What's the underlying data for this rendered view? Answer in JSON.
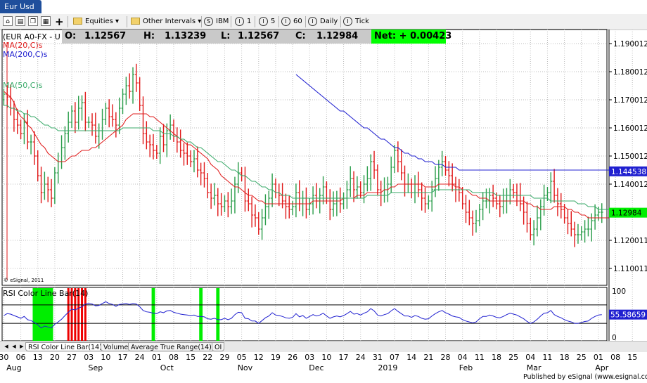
{
  "window": {
    "title": "Eur Usd"
  },
  "toolbar": {
    "equities_label": "Equities",
    "intervals_label": "Other Intervals",
    "intervals": [
      {
        "icon": "S",
        "label": "IBM"
      },
      {
        "icon": "I",
        "label": "1"
      },
      {
        "icon": "I",
        "label": "5"
      },
      {
        "icon": "I",
        "label": "60"
      },
      {
        "icon": "I",
        "label": "Daily"
      },
      {
        "icon": "I",
        "label": "Tick"
      }
    ]
  },
  "header": {
    "symbol": "(EUR A0-FX - U",
    "open_label": "O:",
    "open": "1.12567",
    "high_label": "H:",
    "high": "1.13239",
    "low_label": "L:",
    "low": "1.12567",
    "close_label": "C:",
    "close": "1.12984",
    "net_label": "Net:",
    "net": "+ 0.00423"
  },
  "colors": {
    "up": "#2a9d4a",
    "down": "#e01818",
    "ma20": "#e02020",
    "ma50": "#3aaa6a",
    "ma200": "#2020d0",
    "rsi": "#2020d0",
    "rsi_green": "#00ee00",
    "rsi_red": "#ee0000"
  },
  "chart_data": [
    {
      "type": "candlestick",
      "title": "",
      "copyright": "© eSignal, 2011",
      "ylim": [
        1.104,
        1.195
      ],
      "y_ticks": [
        {
          "value": 1.19,
          "label": "1.190012"
        },
        {
          "value": 1.18,
          "label": "1.180012"
        },
        {
          "value": 1.17,
          "label": "1.170012"
        },
        {
          "value": 1.16,
          "label": "1.160012"
        },
        {
          "value": 1.15,
          "label": "1.150012"
        },
        {
          "value": 1.14,
          "label": "1.140012"
        },
        {
          "value": 1.12,
          "label": "1.120011"
        },
        {
          "value": 1.11,
          "label": "1.110011"
        }
      ],
      "x_ticks": [
        {
          "i": 0,
          "label": "30"
        },
        {
          "i": 5,
          "label": "06"
        },
        {
          "i": 10,
          "label": "13"
        },
        {
          "i": 15,
          "label": "20"
        },
        {
          "i": 20,
          "label": "27"
        },
        {
          "i": 25,
          "label": "03"
        },
        {
          "i": 30,
          "label": "10"
        },
        {
          "i": 35,
          "label": "17"
        },
        {
          "i": 40,
          "label": "24"
        },
        {
          "i": 45,
          "label": "01"
        },
        {
          "i": 50,
          "label": "08"
        },
        {
          "i": 55,
          "label": "15"
        },
        {
          "i": 60,
          "label": "22"
        },
        {
          "i": 65,
          "label": "29"
        },
        {
          "i": 70,
          "label": "05"
        },
        {
          "i": 75,
          "label": "12"
        },
        {
          "i": 80,
          "label": "19"
        },
        {
          "i": 85,
          "label": "26"
        },
        {
          "i": 90,
          "label": "03"
        },
        {
          "i": 95,
          "label": "10"
        },
        {
          "i": 100,
          "label": "17"
        },
        {
          "i": 105,
          "label": "24"
        },
        {
          "i": 110,
          "label": "31"
        },
        {
          "i": 115,
          "label": "07"
        },
        {
          "i": 120,
          "label": "14"
        },
        {
          "i": 125,
          "label": "21"
        },
        {
          "i": 130,
          "label": "28"
        },
        {
          "i": 135,
          "label": "04"
        },
        {
          "i": 140,
          "label": "11"
        },
        {
          "i": 145,
          "label": "18"
        },
        {
          "i": 150,
          "label": "25"
        },
        {
          "i": 155,
          "label": "04"
        },
        {
          "i": 160,
          "label": "11"
        },
        {
          "i": 165,
          "label": "18"
        },
        {
          "i": 170,
          "label": "25"
        },
        {
          "i": 175,
          "label": "01"
        },
        {
          "i": 180,
          "label": "08"
        },
        {
          "i": 185,
          "label": "15"
        }
      ],
      "month_labels": [
        {
          "i": 3,
          "label": "Aug"
        },
        {
          "i": 27,
          "label": "Sep"
        },
        {
          "i": 48,
          "label": "Oct"
        },
        {
          "i": 71,
          "label": "Nov"
        },
        {
          "i": 92,
          "label": "Dec"
        },
        {
          "i": 113,
          "label": "2019"
        },
        {
          "i": 136,
          "label": "Feb"
        },
        {
          "i": 156,
          "label": "Mar"
        },
        {
          "i": 176,
          "label": "Apr"
        }
      ],
      "closes": [
        1.172,
        1.171,
        1.167,
        1.163,
        1.161,
        1.158,
        1.162,
        1.155,
        1.155,
        1.15,
        1.143,
        1.137,
        1.14,
        1.138,
        1.135,
        1.144,
        1.148,
        1.153,
        1.158,
        1.162,
        1.166,
        1.162,
        1.167,
        1.169,
        1.162,
        1.162,
        1.161,
        1.157,
        1.159,
        1.163,
        1.167,
        1.164,
        1.163,
        1.161,
        1.167,
        1.172,
        1.175,
        1.173,
        1.179,
        1.176,
        1.168,
        1.158,
        1.155,
        1.154,
        1.152,
        1.151,
        1.157,
        1.154,
        1.159,
        1.161,
        1.157,
        1.155,
        1.152,
        1.151,
        1.15,
        1.148,
        1.149,
        1.145,
        1.144,
        1.142,
        1.137,
        1.135,
        1.136,
        1.133,
        1.132,
        1.134,
        1.132,
        1.134,
        1.14,
        1.144,
        1.143,
        1.134,
        1.133,
        1.129,
        1.128,
        1.124,
        1.128,
        1.132,
        1.135,
        1.14,
        1.137,
        1.136,
        1.134,
        1.132,
        1.131,
        1.132,
        1.137,
        1.133,
        1.135,
        1.131,
        1.133,
        1.136,
        1.134,
        1.136,
        1.139,
        1.135,
        1.131,
        1.133,
        1.135,
        1.133,
        1.135,
        1.138,
        1.142,
        1.138,
        1.139,
        1.137,
        1.14,
        1.142,
        1.148,
        1.145,
        1.138,
        1.136,
        1.138,
        1.14,
        1.146,
        1.152,
        1.148,
        1.144,
        1.14,
        1.14,
        1.137,
        1.14,
        1.138,
        1.135,
        1.133,
        1.134,
        1.138,
        1.142,
        1.146,
        1.148,
        1.145,
        1.143,
        1.14,
        1.138,
        1.137,
        1.133,
        1.13,
        1.128,
        1.126,
        1.127,
        1.131,
        1.134,
        1.134,
        1.136,
        1.135,
        1.133,
        1.132,
        1.134,
        1.136,
        1.138,
        1.137,
        1.136,
        1.133,
        1.13,
        1.126,
        1.122,
        1.124,
        1.128,
        1.132,
        1.136,
        1.137,
        1.141,
        1.136,
        1.133,
        1.131,
        1.128,
        1.126,
        1.124,
        1.122,
        1.122,
        1.123,
        1.124,
        1.124,
        1.127,
        1.129,
        1.13,
        1.13
      ],
      "series": [
        {
          "name": "MA(20,C)s",
          "values": [
            1.173,
            1.172,
            1.171,
            1.169,
            1.166,
            1.164,
            1.163,
            1.161,
            1.16,
            1.158,
            1.156,
            1.154,
            1.153,
            1.151,
            1.15,
            1.149,
            1.148,
            1.148,
            1.148,
            1.149,
            1.15,
            1.15,
            1.151,
            1.152,
            1.152,
            1.152,
            1.153,
            1.153,
            1.154,
            1.155,
            1.156,
            1.157,
            1.158,
            1.159,
            1.16,
            1.161,
            1.163,
            1.164,
            1.165,
            1.165,
            1.165,
            1.165,
            1.165,
            1.164,
            1.164,
            1.163,
            1.162,
            1.161,
            1.16,
            1.159,
            1.158,
            1.157,
            1.156,
            1.155,
            1.154,
            1.154,
            1.153,
            1.152,
            1.151,
            1.15,
            1.149,
            1.147,
            1.146,
            1.145,
            1.143,
            1.142,
            1.141,
            1.14,
            1.139,
            1.139,
            1.138,
            1.137,
            1.136,
            1.136,
            1.135,
            1.134,
            1.134,
            1.133,
            1.133,
            1.133,
            1.133,
            1.133,
            1.133,
            1.133,
            1.133,
            1.133,
            1.133,
            1.133,
            1.133,
            1.133,
            1.133,
            1.134,
            1.134,
            1.134,
            1.134,
            1.134,
            1.134,
            1.134,
            1.134,
            1.134,
            1.135,
            1.135,
            1.135,
            1.135,
            1.136,
            1.136,
            1.136,
            1.137,
            1.137,
            1.137,
            1.137,
            1.137,
            1.138,
            1.138,
            1.139,
            1.139,
            1.14,
            1.14,
            1.14,
            1.14,
            1.14,
            1.14,
            1.14,
            1.14,
            1.139,
            1.139,
            1.139,
            1.139,
            1.14,
            1.14,
            1.14,
            1.14,
            1.14,
            1.139,
            1.139,
            1.138,
            1.138,
            1.137,
            1.136,
            1.136,
            1.135,
            1.135,
            1.135,
            1.134,
            1.134,
            1.134,
            1.134,
            1.134,
            1.134,
            1.134,
            1.134,
            1.134,
            1.134,
            1.134,
            1.133,
            1.133,
            1.132,
            1.132,
            1.131,
            1.131,
            1.131,
            1.131,
            1.132,
            1.132,
            1.132,
            1.132,
            1.131,
            1.131,
            1.13,
            1.13,
            1.129,
            1.129,
            1.128,
            1.128,
            1.128,
            1.128,
            1.128,
            1.128,
            1.128
          ]
        },
        {
          "name": "MA(50,C)s",
          "values": [
            1.168,
            1.168,
            1.167,
            1.167,
            1.166,
            1.166,
            1.165,
            1.165,
            1.164,
            1.164,
            1.163,
            1.162,
            1.161,
            1.161,
            1.16,
            1.16,
            1.159,
            1.159,
            1.159,
            1.159,
            1.159,
            1.159,
            1.159,
            1.159,
            1.159,
            1.159,
            1.159,
            1.159,
            1.159,
            1.159,
            1.159,
            1.159,
            1.159,
            1.159,
            1.159,
            1.16,
            1.16,
            1.16,
            1.16,
            1.16,
            1.16,
            1.16,
            1.16,
            1.16,
            1.159,
            1.159,
            1.159,
            1.158,
            1.158,
            1.158,
            1.157,
            1.157,
            1.156,
            1.156,
            1.155,
            1.155,
            1.154,
            1.153,
            1.153,
            1.152,
            1.151,
            1.15,
            1.149,
            1.148,
            1.148,
            1.147,
            1.146,
            1.145,
            1.145,
            1.144,
            1.143,
            1.143,
            1.142,
            1.141,
            1.141,
            1.14,
            1.139,
            1.139,
            1.138,
            1.138,
            1.137,
            1.137,
            1.136,
            1.136,
            1.136,
            1.135,
            1.135,
            1.135,
            1.135,
            1.135,
            1.135,
            1.135,
            1.135,
            1.135,
            1.135,
            1.135,
            1.135,
            1.135,
            1.135,
            1.135,
            1.135,
            1.135,
            1.135,
            1.135,
            1.135,
            1.135,
            1.135,
            1.136,
            1.136,
            1.136,
            1.136,
            1.136,
            1.136,
            1.136,
            1.137,
            1.137,
            1.137,
            1.137,
            1.137,
            1.137,
            1.137,
            1.137,
            1.137,
            1.137,
            1.137,
            1.137,
            1.137,
            1.138,
            1.138,
            1.138,
            1.138,
            1.138,
            1.138,
            1.138,
            1.138,
            1.138,
            1.138,
            1.138,
            1.137,
            1.137,
            1.137,
            1.137,
            1.137,
            1.137,
            1.137,
            1.136,
            1.136,
            1.136,
            1.136,
            1.136,
            1.136,
            1.136,
            1.136,
            1.136,
            1.136,
            1.136,
            1.135,
            1.135,
            1.135,
            1.135,
            1.135,
            1.134,
            1.134,
            1.134,
            1.134,
            1.134,
            1.134,
            1.134,
            1.134,
            1.133,
            1.133,
            1.133,
            1.132,
            1.132,
            1.132,
            1.131,
            1.131,
            1.131,
            1.131,
            1.13,
            1.13,
            1.13,
            1.13
          ]
        },
        {
          "name": "MA(200,C)s",
          "start": 86,
          "values": [
            1.179,
            1.178,
            1.177,
            1.176,
            1.175,
            1.174,
            1.173,
            1.172,
            1.171,
            1.17,
            1.169,
            1.168,
            1.167,
            1.166,
            1.166,
            1.165,
            1.164,
            1.163,
            1.162,
            1.161,
            1.16,
            1.16,
            1.159,
            1.158,
            1.157,
            1.156,
            1.156,
            1.155,
            1.154,
            1.153,
            1.153,
            1.152,
            1.151,
            1.151,
            1.15,
            1.15,
            1.149,
            1.149,
            1.148,
            1.148,
            1.148,
            1.147,
            1.147,
            1.147,
            1.146,
            1.146,
            1.146,
            1.146,
            1.145,
            1.145,
            1.145,
            1.145,
            1.145,
            1.145,
            1.145,
            1.145,
            1.145,
            1.145,
            1.145,
            1.145,
            1.145,
            1.145,
            1.145,
            1.145,
            1.145,
            1.145,
            1.145,
            1.145,
            1.145,
            1.145,
            1.145,
            1.145,
            1.145,
            1.145,
            1.145,
            1.145,
            1.145,
            1.145,
            1.145,
            1.145,
            1.145,
            1.145,
            1.145,
            1.145,
            1.145,
            1.145,
            1.145,
            1.145,
            1.145,
            1.145,
            1.145,
            1.145,
            1.145,
            1.145,
            1.145,
            1.145,
            1.145,
            1.145,
            1.145,
            1.145
          ]
        }
      ],
      "last_price_labels": [
        {
          "value": 1.144538,
          "label": "1.144538",
          "color": "#2020d0"
        },
        {
          "value": 1.12984,
          "label": "1.12984",
          "color": "#00ee00"
        }
      ]
    },
    {
      "type": "line",
      "title": "RSI Color Line Bar(14)",
      "ylim": [
        -8,
        108
      ],
      "y_ticks": [
        {
          "value": 100,
          "label": "100"
        },
        {
          "value": 0,
          "label": "0"
        }
      ],
      "bands": [
        70,
        30
      ],
      "values": [
        47,
        51,
        50,
        47,
        44,
        41,
        45,
        38,
        36,
        32,
        27,
        20,
        24,
        22,
        20,
        28,
        33,
        39,
        47,
        54,
        61,
        59,
        63,
        66,
        72,
        73,
        72,
        68,
        69,
        73,
        77,
        73,
        71,
        67,
        71,
        72,
        73,
        71,
        73,
        72,
        66,
        58,
        55,
        54,
        52,
        51,
        55,
        53,
        57,
        58,
        54,
        52,
        50,
        49,
        48,
        47,
        48,
        45,
        45,
        44,
        40,
        39,
        41,
        38,
        38,
        41,
        38,
        41,
        49,
        54,
        53,
        41,
        40,
        35,
        35,
        30,
        36,
        42,
        46,
        53,
        48,
        47,
        45,
        42,
        41,
        43,
        51,
        44,
        47,
        41,
        45,
        49,
        46,
        48,
        52,
        46,
        41,
        44,
        46,
        44,
        47,
        51,
        56,
        50,
        51,
        48,
        52,
        55,
        62,
        57,
        48,
        46,
        49,
        51,
        57,
        62,
        56,
        51,
        46,
        46,
        43,
        47,
        45,
        41,
        39,
        40,
        46,
        51,
        55,
        58,
        53,
        50,
        46,
        44,
        43,
        38,
        35,
        33,
        31,
        33,
        40,
        45,
        45,
        48,
        46,
        43,
        42,
        45,
        49,
        52,
        50,
        48,
        44,
        40,
        34,
        30,
        33,
        39,
        46,
        52,
        53,
        58,
        49,
        45,
        42,
        38,
        35,
        33,
        30,
        30,
        32,
        34,
        35,
        41,
        45,
        48,
        49
      ],
      "value_label": "55.58659",
      "green_bars": [
        [
          9,
          14
        ],
        [
          44,
          44
        ],
        [
          58,
          58
        ],
        [
          63,
          63
        ]
      ],
      "red_bars": [
        19,
        20,
        21,
        22,
        23,
        24
      ]
    }
  ],
  "bottom_tabs": [
    "RSI Color Line Bar(14)",
    "Volume",
    "Average True Range(14)",
    "OI"
  ],
  "footer": "Published by eSignal (www.esignal.com)"
}
